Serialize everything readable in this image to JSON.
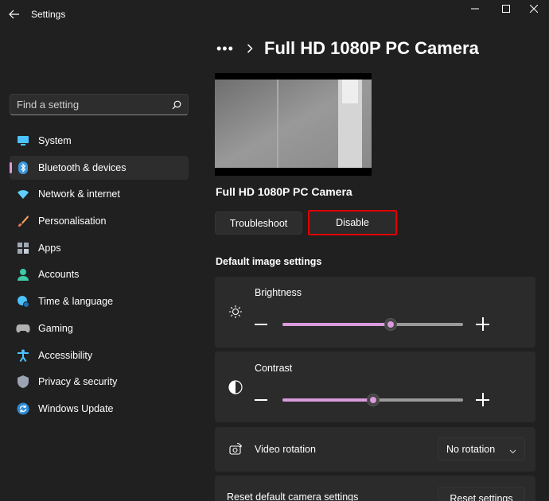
{
  "window": {
    "title": "Settings"
  },
  "search": {
    "placeholder": "Find a setting"
  },
  "sidebar": {
    "items": [
      {
        "label": "System",
        "icon": "system-icon",
        "color": "#4cc2ff"
      },
      {
        "label": "Bluetooth & devices",
        "icon": "bluetooth-icon",
        "color": "#3a96dd",
        "active": true
      },
      {
        "label": "Network & internet",
        "icon": "wifi-icon",
        "color": "#60cdff"
      },
      {
        "label": "Personalisation",
        "icon": "brush-icon",
        "color": "#f7a35c"
      },
      {
        "label": "Apps",
        "icon": "apps-icon",
        "color": "#a0a8b8"
      },
      {
        "label": "Accounts",
        "icon": "person-icon",
        "color": "#3ec9a7"
      },
      {
        "label": "Time & language",
        "icon": "globe-clock-icon",
        "color": "#4cc2ff"
      },
      {
        "label": "Gaming",
        "icon": "gamepad-icon",
        "color": "#b0b0b0"
      },
      {
        "label": "Accessibility",
        "icon": "accessibility-icon",
        "color": "#4cc2ff"
      },
      {
        "label": "Privacy & security",
        "icon": "shield-icon",
        "color": "#9aa4b2"
      },
      {
        "label": "Windows Update",
        "icon": "update-icon",
        "color": "#2b8ad6"
      }
    ]
  },
  "breadcrumb": {
    "overflow": "•••",
    "title": "Full HD 1080P PC Camera"
  },
  "camera": {
    "name": "Full HD 1080P PC Camera",
    "troubleshoot_label": "Troubleshoot",
    "disable_label": "Disable"
  },
  "image_settings": {
    "section_label": "Default image settings",
    "brightness": {
      "label": "Brightness",
      "value_fraction": 0.6
    },
    "contrast": {
      "label": "Contrast",
      "value_fraction": 0.5
    },
    "rotation": {
      "label": "Video rotation",
      "selected": "No rotation"
    },
    "reset": {
      "label": "Reset default camera settings",
      "button_label": "Reset settings"
    }
  },
  "colors": {
    "accent": "#d99bdb",
    "highlight_border": "#e00000",
    "background": "#202020",
    "card": "#2b2b2b"
  }
}
